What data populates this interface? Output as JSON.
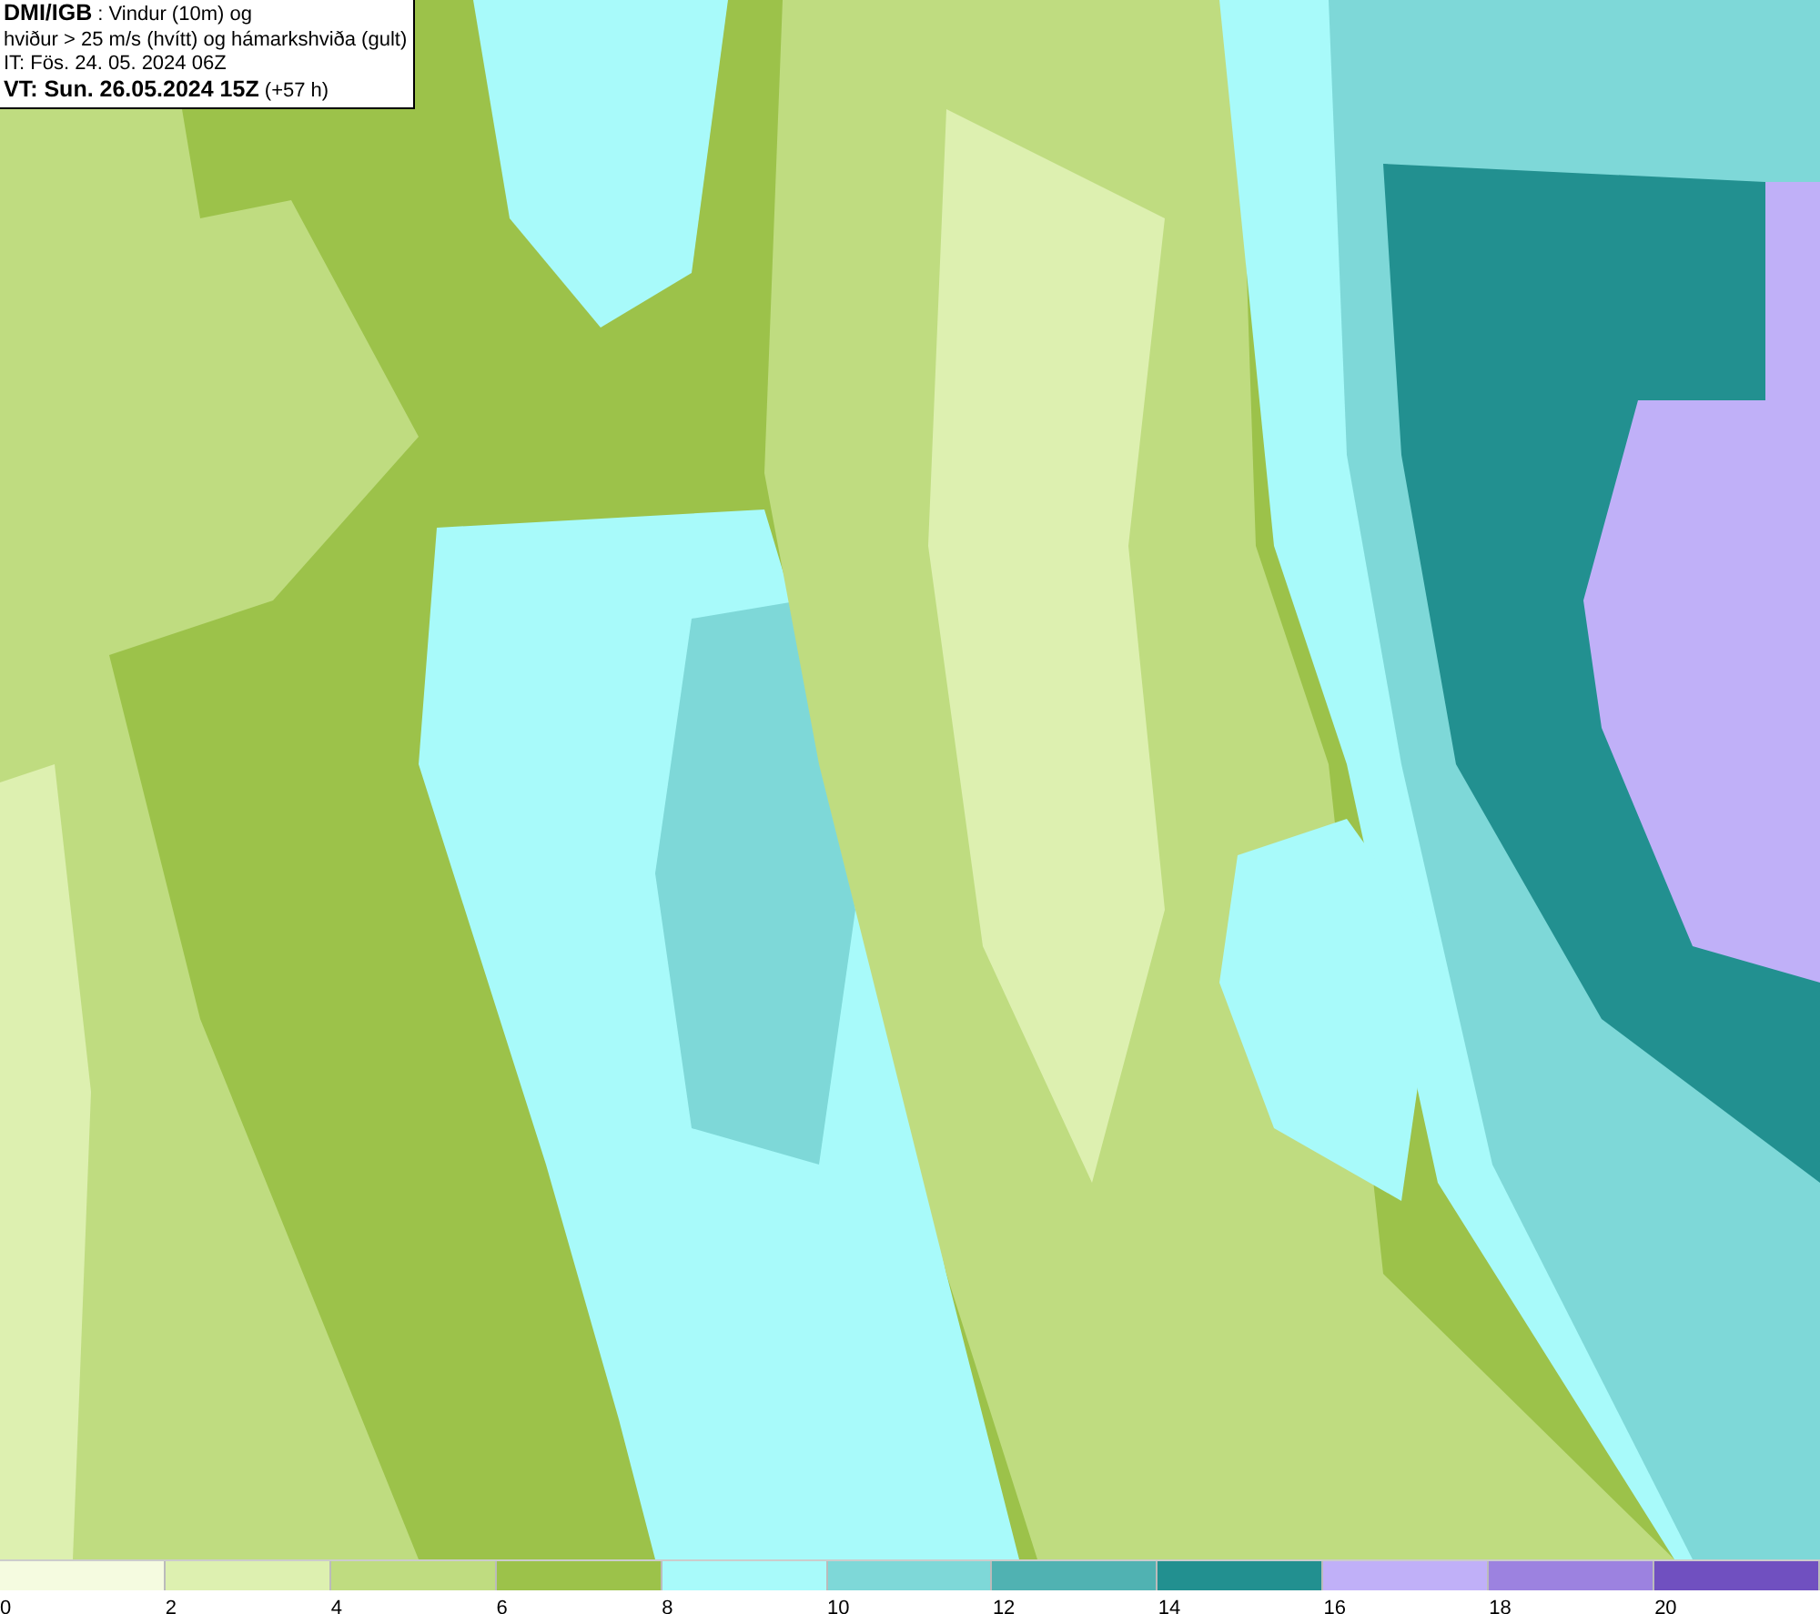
{
  "header": {
    "lines": [
      "**DMI/IGB** : Vindur (10m) og",
      "hviður > 25 m/s (hvítt) og hámarkshviða (gult)",
      "IT: Fös. 24. 05. 2024 06Z",
      "**VT: Sun. 26.05.2024 15Z** (+57 h)"
    ]
  },
  "legend": {
    "bins": [
      {
        "color": "#f5fbe0",
        "label": "0"
      },
      {
        "color": "#ddf0b0",
        "label": "2"
      },
      {
        "color": "#bfdc80",
        "label": "4"
      },
      {
        "color": "#9cc24a",
        "label": "6"
      },
      {
        "color": "#a8fafa",
        "label": "8"
      },
      {
        "color": "#7ed8d8",
        "label": "10"
      },
      {
        "color": "#50b2b2",
        "label": "12"
      },
      {
        "color": "#229090",
        "label": "14"
      },
      {
        "color": "#c0b0f8",
        "label": "16"
      },
      {
        "color": "#9c82e0",
        "label": "18"
      },
      {
        "color": "#7050c0",
        "label": "20"
      }
    ]
  }
}
